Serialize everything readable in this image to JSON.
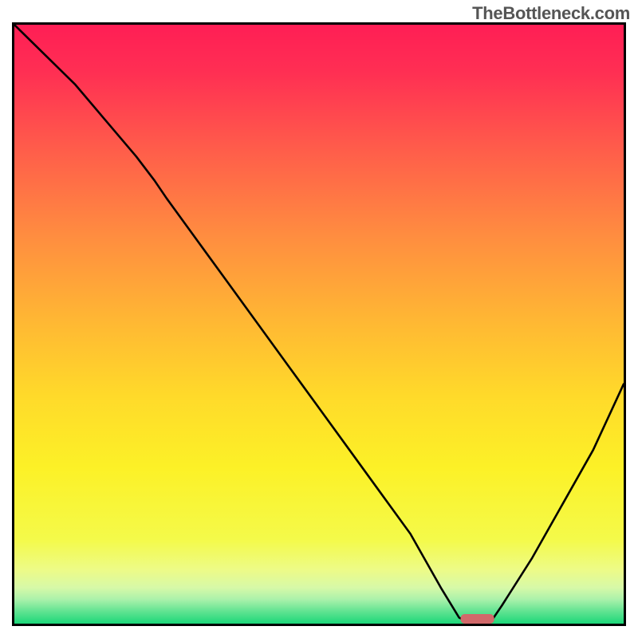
{
  "watermark": "TheBottleneck.com",
  "chart_data": {
    "type": "line",
    "title": "",
    "xlabel": "",
    "ylabel": "",
    "xlim": [
      0,
      100
    ],
    "ylim": [
      0,
      100
    ],
    "grid": false,
    "legend": false,
    "series": [
      {
        "name": "bottleneck-curve",
        "x": [
          0,
          5,
          10,
          15,
          20,
          23,
          25,
          30,
          35,
          40,
          45,
          50,
          55,
          60,
          65,
          70,
          73,
          75,
          78,
          80,
          85,
          90,
          95,
          100
        ],
        "y": [
          100,
          95,
          90,
          84,
          78,
          74,
          71,
          64,
          57,
          50,
          43,
          36,
          29,
          22,
          15,
          6,
          1,
          0,
          0,
          3,
          11,
          20,
          29,
          40
        ]
      }
    ],
    "optimal_marker": {
      "x_center": 76,
      "width": 5.5,
      "color_hex": "#d1696a"
    },
    "background_gradient_stops": [
      {
        "pct": 0,
        "hex": "#ff1e55"
      },
      {
        "pct": 8,
        "hex": "#ff2f53"
      },
      {
        "pct": 20,
        "hex": "#ff5a4b"
      },
      {
        "pct": 35,
        "hex": "#ff8c40"
      },
      {
        "pct": 50,
        "hex": "#ffb933"
      },
      {
        "pct": 62,
        "hex": "#ffda2a"
      },
      {
        "pct": 74,
        "hex": "#fcf127"
      },
      {
        "pct": 86,
        "hex": "#f4fa4a"
      },
      {
        "pct": 91,
        "hex": "#edfb87"
      },
      {
        "pct": 94,
        "hex": "#d7f9a8"
      },
      {
        "pct": 96,
        "hex": "#a9f1aa"
      },
      {
        "pct": 98,
        "hex": "#5fe391"
      },
      {
        "pct": 100,
        "hex": "#1cd779"
      }
    ]
  }
}
